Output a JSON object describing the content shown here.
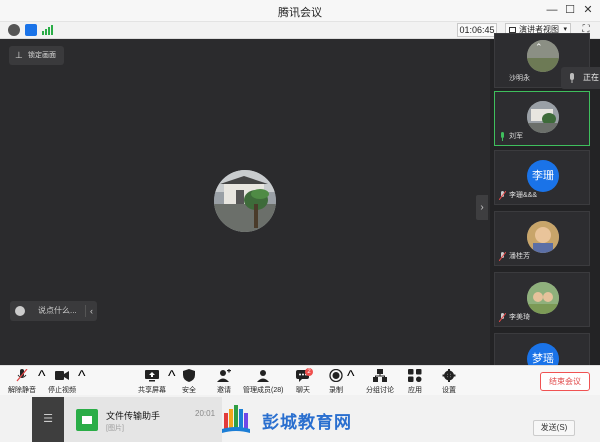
{
  "window": {
    "title": "腾讯会议"
  },
  "infobar": {
    "timer": "01:06:45",
    "view_label": "演讲者视图"
  },
  "stage": {
    "lock_label": "锁定画面",
    "say_placeholder": "说点什么..."
  },
  "participants": [
    {
      "name": "沙明永"
    },
    {
      "name": "刘军",
      "speaking": true
    },
    {
      "name": "李珊",
      "avatar_text": "李珊",
      "name_suffix": "李珊&&&"
    },
    {
      "name": "潘桂芳"
    },
    {
      "name": "李美琦"
    },
    {
      "name": "",
      "avatar_text": "梦瑶"
    }
  ],
  "talking_label": "正在",
  "toolbar": {
    "mute": "解除静音",
    "video": "停止视频",
    "share": "共享屏幕",
    "security": "安全",
    "invite": "邀请",
    "members": "管理成员(28)",
    "chat": "聊天",
    "chat_badge": "2",
    "record": "录制",
    "breakout": "分组讨论",
    "apps": "应用",
    "settings": "设置",
    "end": "结束会议"
  },
  "chat_panel": {
    "name": "文件传输助手",
    "time": "20:01",
    "preview": "[图片]"
  },
  "logo_text": "彭城教育网",
  "send_label": "发送(S)",
  "colors": {
    "accent_green": "#3fbf5d",
    "end_red": "#e14848",
    "brand_blue": "#2a6fcf"
  }
}
